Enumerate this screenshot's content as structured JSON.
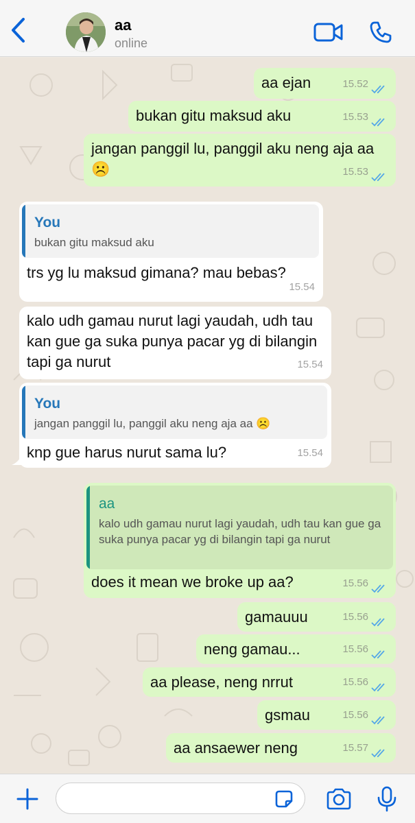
{
  "header": {
    "contact_name": "aa",
    "status": "online"
  },
  "colors": {
    "accent": "#0a63d8",
    "outgoing_bubble": "#dcf8c6",
    "incoming_bubble": "#ffffff",
    "quote_name_you": "#2677b9",
    "quote_name_aa": "#1c9480",
    "read_ticks": "#53a6e8"
  },
  "messages": [
    {
      "dir": "out",
      "text": "aa ejan",
      "time": "15.52"
    },
    {
      "dir": "out",
      "text": "bukan gitu maksud aku",
      "time": "15.53"
    },
    {
      "dir": "out",
      "text": "jangan panggil lu, panggil aku neng aja aa ☹️",
      "time": "15.53"
    },
    {
      "dir": "in",
      "quote": {
        "name": "You",
        "text": "bukan gitu maksud aku"
      },
      "text": "trs yg lu maksud gimana? mau bebas?",
      "time": "15.54"
    },
    {
      "dir": "in",
      "text": "kalo udh gamau nurut lagi yaudah, udh tau kan gue ga suka punya pacar yg di bilangin tapi ga nurut",
      "time": "15.54"
    },
    {
      "dir": "in",
      "quote": {
        "name": "You",
        "text": "jangan panggil lu, panggil aku neng aja aa ☹️"
      },
      "text": "knp gue harus nurut sama lu?",
      "time": "15.54"
    },
    {
      "dir": "out",
      "quote": {
        "name": "aa",
        "text": "kalo udh gamau nurut lagi yaudah, udh tau kan gue ga suka punya pacar yg di bilangin tapi ga nurut"
      },
      "text": "does it mean we broke up aa?",
      "time": "15.56"
    },
    {
      "dir": "out",
      "text": "gamauuu",
      "time": "15.56"
    },
    {
      "dir": "out",
      "text": "neng gamau...",
      "time": "15.56"
    },
    {
      "dir": "out",
      "text": "aa please, neng nrrut",
      "time": "15.56"
    },
    {
      "dir": "out",
      "text": "gsmau",
      "time": "15.56"
    },
    {
      "dir": "out",
      "text": "aa ansaewer neng",
      "time": "15.57"
    }
  ],
  "footer": {
    "input_value": ""
  },
  "icons": {
    "back": "chevron-left-icon",
    "video": "video-camera-icon",
    "call": "phone-icon",
    "add": "plus-icon",
    "sticker": "sticker-icon",
    "camera": "camera-icon",
    "mic": "microphone-icon",
    "ticks": "double-check-icon"
  }
}
